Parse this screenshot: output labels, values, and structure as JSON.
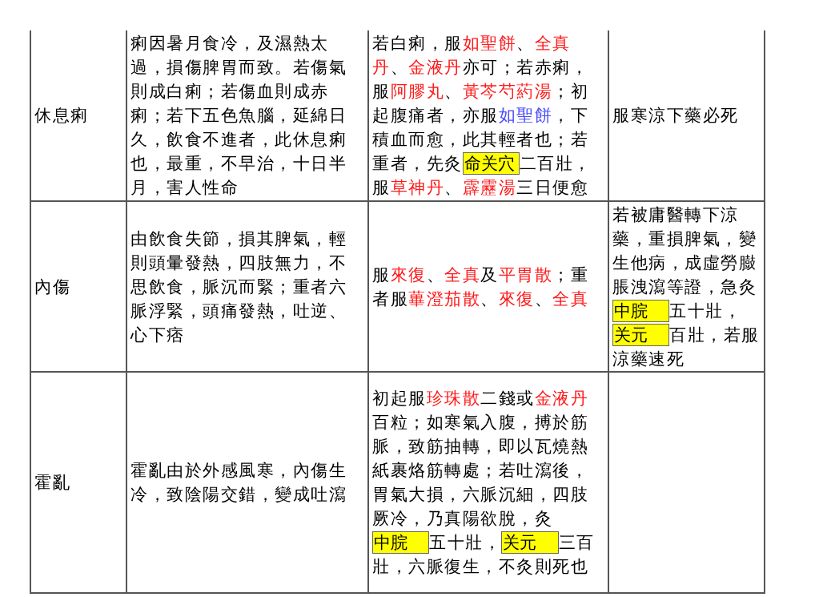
{
  "table": {
    "rows": [
      {
        "cells": [
          {
            "segments": [
              {
                "kind": "text",
                "text": "休息痢"
              }
            ]
          },
          {
            "segments": [
              {
                "kind": "text",
                "text": "痢因暑月食冷，及濕熱太過，損傷脾胃而致。若傷氣則成白痢；若傷血則成赤痢；若下五色魚腦，延綿日久，飲食不進者，此休息痢也，最重，不早治，十日半月，害人性命"
              }
            ]
          },
          {
            "segments": [
              {
                "kind": "text",
                "text": "若白痢，服"
              },
              {
                "kind": "drug",
                "text": "如聖餅"
              },
              {
                "kind": "text",
                "text": "、"
              },
              {
                "kind": "drug",
                "text": "全真丹"
              },
              {
                "kind": "text",
                "text": "、"
              },
              {
                "kind": "drug",
                "text": "金液丹"
              },
              {
                "kind": "text",
                "text": "亦可；若赤痢，服"
              },
              {
                "kind": "drug",
                "text": "阿膠丸"
              },
              {
                "kind": "text",
                "text": "、"
              },
              {
                "kind": "drug",
                "text": "黃芩芍葯湯"
              },
              {
                "kind": "text",
                "text": "；初起腹痛者，亦服"
              },
              {
                "kind": "link",
                "text": "如聖餅"
              },
              {
                "kind": "text",
                "text": "，下積血而愈，此其輕者也；若重者，先灸"
              },
              {
                "kind": "point",
                "text": "命关穴"
              },
              {
                "kind": "text",
                "text": "二百壯，服"
              },
              {
                "kind": "drug",
                "text": "草神丹"
              },
              {
                "kind": "text",
                "text": "、"
              },
              {
                "kind": "drug",
                "text": "霹靂湯"
              },
              {
                "kind": "text",
                "text": "三日便愈"
              }
            ]
          },
          {
            "segments": [
              {
                "kind": "text",
                "text": "服寒涼下藥必死"
              }
            ]
          }
        ]
      },
      {
        "cells": [
          {
            "segments": [
              {
                "kind": "text",
                "text": "內傷"
              }
            ]
          },
          {
            "segments": [
              {
                "kind": "text",
                "text": "由飲食失節，損其脾氣，輕則頭暈發熱，四肢無力，不思飲食，脈沉而緊；重者六脈浮緊，頭痛發熱，吐逆、心下痞"
              }
            ]
          },
          {
            "segments": [
              {
                "kind": "text",
                "text": "服"
              },
              {
                "kind": "drug",
                "text": "來復"
              },
              {
                "kind": "text",
                "text": "、"
              },
              {
                "kind": "drug",
                "text": "全真"
              },
              {
                "kind": "text",
                "text": "及"
              },
              {
                "kind": "drug",
                "text": "平胃散"
              },
              {
                "kind": "text",
                "text": "；重者服"
              },
              {
                "kind": "drug",
                "text": "蓽澄茄散"
              },
              {
                "kind": "text",
                "text": "、"
              },
              {
                "kind": "drug",
                "text": "來復"
              },
              {
                "kind": "text",
                "text": "、"
              },
              {
                "kind": "drug",
                "text": "全真"
              }
            ]
          },
          {
            "segments": [
              {
                "kind": "text",
                "text": "若被庸醫轉下涼藥，重損脾氣，變生他病，成虛勞臌脹洩瀉等證，急灸"
              },
              {
                "kind": "point",
                "text": "中脘"
              },
              {
                "kind": "text",
                "text": "五十壯，"
              },
              {
                "kind": "point",
                "text": "关元"
              },
              {
                "kind": "text",
                "text": "百壯，若服涼藥速死"
              }
            ]
          }
        ]
      },
      {
        "cells": [
          {
            "segments": [
              {
                "kind": "text",
                "text": "霍亂"
              }
            ]
          },
          {
            "segments": [
              {
                "kind": "text",
                "text": "霍亂由於外感風寒，內傷生冷，致陰陽交錯，變成吐瀉"
              }
            ]
          },
          {
            "segments": [
              {
                "kind": "text",
                "text": "初起服"
              },
              {
                "kind": "drug",
                "text": "珍珠散"
              },
              {
                "kind": "text",
                "text": "二錢或"
              },
              {
                "kind": "drug",
                "text": "金液丹"
              },
              {
                "kind": "text",
                "text": "百粒；如寒氣入腹，搏於筋脈，致筋抽轉，即以瓦燒熱紙裹烙筋轉處；若吐瀉後，胃氣大損，六脈沉細，四肢厥冷，乃真陽欲脫，灸"
              },
              {
                "kind": "point",
                "text": "中脘"
              },
              {
                "kind": "text",
                "text": "五十壯，"
              },
              {
                "kind": "point",
                "text": "关元"
              },
              {
                "kind": "text",
                "text": "三百壯，六脈復生，不灸則死也"
              }
            ]
          },
          {}
        ]
      }
    ]
  }
}
